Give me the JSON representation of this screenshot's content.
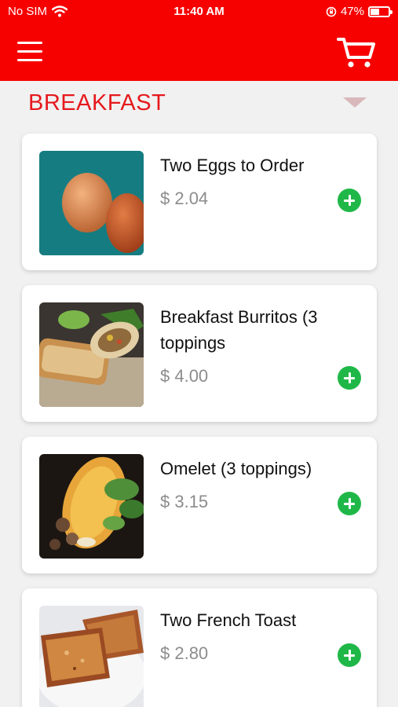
{
  "status_bar": {
    "carrier": "No SIM",
    "time": "11:40 AM",
    "battery": "47%"
  },
  "header": {
    "menu_icon": "hamburger-menu-icon",
    "cart_icon": "shopping-cart-icon"
  },
  "category": {
    "title": "BREAKFAST",
    "toggle_icon": "caret-down-icon"
  },
  "items": [
    {
      "name": "Two Eggs to Order",
      "price": "$ 2.04",
      "image": "eggs-photo"
    },
    {
      "name": "Breakfast Burritos (3 toppings",
      "price": "$ 4.00",
      "image": "burrito-photo"
    },
    {
      "name": "Omelet (3 toppings)",
      "price": "$ 3.15",
      "image": "omelet-photo"
    },
    {
      "name": "Two French Toast",
      "price": "$ 2.80",
      "image": "french-toast-photo"
    }
  ],
  "colors": {
    "brand": "#f70000",
    "category": "#e6191e",
    "add": "#1fb848",
    "price": "#8c8c8c"
  }
}
